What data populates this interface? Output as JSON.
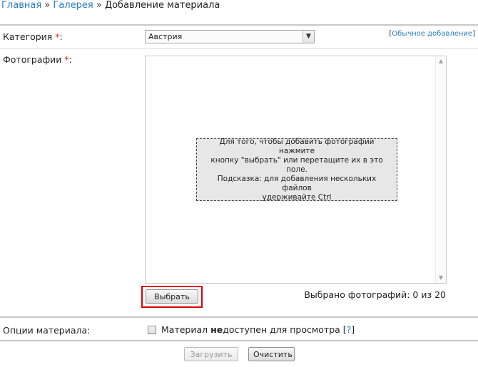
{
  "breadcrumb": {
    "home": "Главная",
    "sep1": "»",
    "gallery": "Галерея",
    "sep2": "»",
    "current": "Добавление материала"
  },
  "category": {
    "label": "Категория",
    "required_mark": "*",
    "colon": ":",
    "selected": "Австрия"
  },
  "normal_add": {
    "open": "[",
    "link": "Обычное добавление",
    "close": "]"
  },
  "photos": {
    "label": "Фотографии",
    "required_mark": "*",
    "colon": ":",
    "hint_line1": "Для того, чтобы добавить фотографии нажмите",
    "hint_line2": "кнопку \"выбрать\" или перетащите их в это поле.",
    "hint_line3": "Подсказка: для добавления нескольких файлов",
    "hint_line4": "удерживайте Ctrl",
    "pick_button": "Выбрать",
    "selected_count": "Выбрано фотографий: 0 из 20"
  },
  "options": {
    "label": "Опции материала:",
    "checkbox_pre": "Материал ",
    "checkbox_bold": "не",
    "checkbox_post": "доступен для просмотра ",
    "help_open": "[",
    "help_link": "?",
    "help_close": "]"
  },
  "actions": {
    "upload": "Загрузить",
    "clear": "Очистить"
  }
}
